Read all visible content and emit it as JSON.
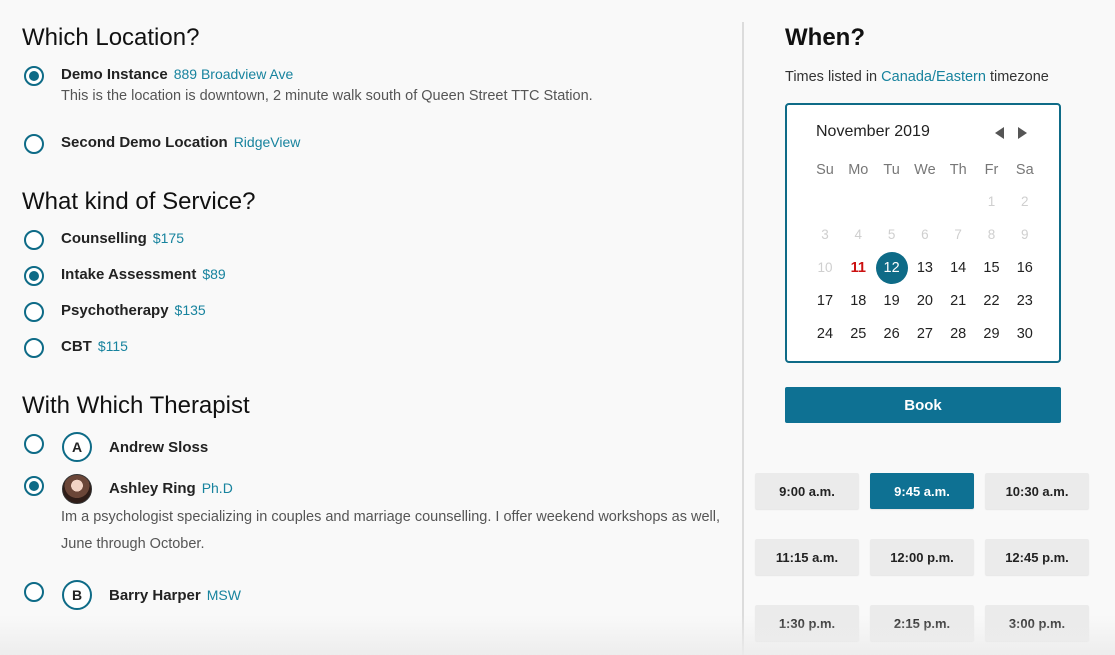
{
  "location": {
    "heading": "Which Location?",
    "options": [
      {
        "name": "Demo Instance",
        "sub": "889 Broadview Ave",
        "desc": "This is the location is downtown, 2 minute walk south of Queen Street TTC Station.",
        "checked": true
      },
      {
        "name": "Second Demo Location",
        "sub": "RidgeView",
        "checked": false
      }
    ]
  },
  "service": {
    "heading": "What kind of Service?",
    "options": [
      {
        "name": "Counselling",
        "price": "$175",
        "checked": false
      },
      {
        "name": "Intake Assessment",
        "price": "$89",
        "checked": true
      },
      {
        "name": "Psychotherapy",
        "price": "$135",
        "checked": false
      },
      {
        "name": "CBT",
        "price": "$115",
        "checked": false
      }
    ]
  },
  "therapist": {
    "heading": "With Which Therapist",
    "options": [
      {
        "name": "Andrew Sloss",
        "initial": "A",
        "credential": "",
        "checked": false
      },
      {
        "name": "Ashley Ring",
        "credential": "Ph.D",
        "desc": "Im a psychologist specializing in couples and marriage counselling. I offer weekend workshops as well, June through October.",
        "checked": true
      },
      {
        "name": "Barry Harper",
        "initial": "B",
        "credential": "MSW",
        "checked": false
      }
    ]
  },
  "when": {
    "heading": "When?",
    "tz_prefix": "Times listed in ",
    "tz_link": "Canada/Eastern",
    "tz_suffix": " timezone"
  },
  "calendar": {
    "month": "November 2019",
    "weekdays": [
      "Su",
      "Mo",
      "Tu",
      "We",
      "Th",
      "Fr",
      "Sa"
    ],
    "weeks": [
      [
        null,
        null,
        null,
        null,
        null,
        "1",
        "2"
      ],
      [
        "3",
        "4",
        "5",
        "6",
        "7",
        "8",
        "9"
      ],
      [
        "10",
        "11",
        "12",
        "13",
        "14",
        "15",
        "16"
      ],
      [
        "17",
        "18",
        "19",
        "20",
        "21",
        "22",
        "23"
      ],
      [
        "24",
        "25",
        "26",
        "27",
        "28",
        "29",
        "30"
      ]
    ],
    "disabled": [
      "1",
      "2",
      "3",
      "4",
      "5",
      "6",
      "7",
      "8",
      "9",
      "10"
    ],
    "today": "11",
    "selected": "12"
  },
  "book_label": "Book",
  "slots": {
    "times": [
      "9:00 a.m.",
      "9:45 a.m.",
      "10:30 a.m.",
      "11:15 a.m.",
      "12:00 p.m.",
      "12:45 p.m.",
      "1:30 p.m.",
      "2:15 p.m.",
      "3:00 p.m."
    ],
    "selected": "9:45 a.m."
  },
  "colors": {
    "accent": "#0e7193",
    "link": "#17839e",
    "today": "#cc1111"
  }
}
